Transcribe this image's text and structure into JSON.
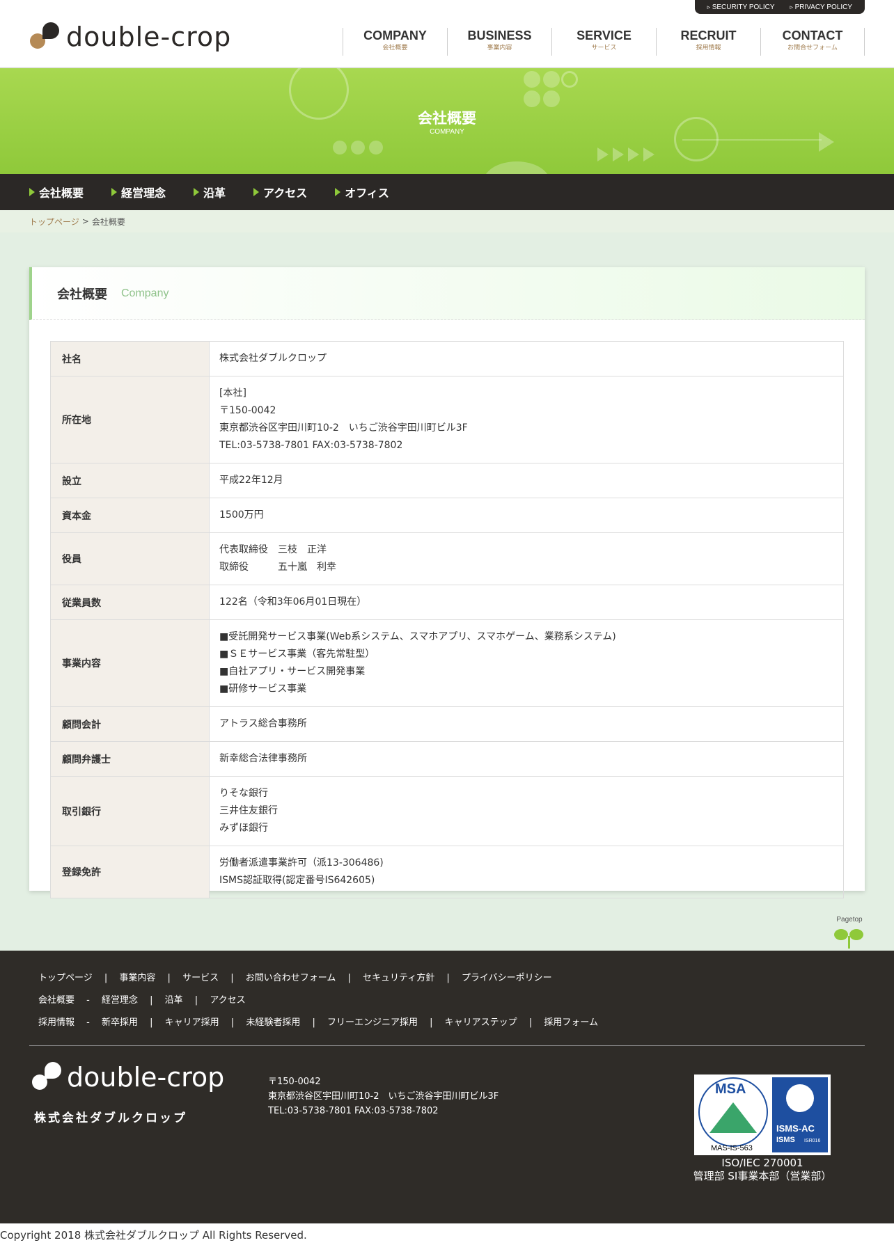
{
  "header": {
    "logo_text": "double-crop",
    "utility": [
      "SECURITY POLICY",
      "PRIVACY POLICY"
    ],
    "nav": [
      {
        "en": "COMPANY",
        "ja": "会社概要"
      },
      {
        "en": "BUSINESS",
        "ja": "事業内容"
      },
      {
        "en": "SERVICE",
        "ja": "サービス"
      },
      {
        "en": "RECRUIT",
        "ja": "採用情報"
      },
      {
        "en": "CONTACT",
        "ja": "お問合せフォーム"
      }
    ]
  },
  "hero": {
    "title": "会社概要",
    "subtitle": "COMPANY"
  },
  "subnav": [
    "会社概要",
    "経営理念",
    "沿革",
    "アクセス",
    "オフィス"
  ],
  "breadcrumb": {
    "home": "トップページ",
    "sep": ">",
    "current": "会社概要"
  },
  "card": {
    "title": "会社概要",
    "title_en": "Company",
    "rows": [
      {
        "label": "社名",
        "lines": [
          "株式会社ダブルクロップ"
        ]
      },
      {
        "label": "所在地",
        "lines": [
          "[本社]",
          "〒150-0042",
          "東京都渋谷区宇田川町10-2　いちご渋谷宇田川町ビル3F",
          "TEL:03-5738-7801 FAX:03-5738-7802"
        ]
      },
      {
        "label": "設立",
        "lines": [
          "平成22年12月"
        ]
      },
      {
        "label": "資本金",
        "lines": [
          "1500万円"
        ]
      },
      {
        "label": "役員",
        "lines": [
          "代表取締役　三枝　正洋",
          "取締役　　　五十嵐　利幸"
        ]
      },
      {
        "label": "従業員数",
        "lines": [
          "122名（令和3年06月01日現在）"
        ]
      },
      {
        "label": "事業内容",
        "lines": [
          "■受託開発サービス事業(Web系システム、スマホアプリ、スマホゲーム、業務系システム)",
          "■ＳＥサービス事業（客先常駐型）",
          "■自社アプリ・サービス開発事業",
          "■研修サービス事業"
        ]
      },
      {
        "label": "顧問会計",
        "lines": [
          "アトラス総合事務所"
        ]
      },
      {
        "label": "顧問弁護士",
        "lines": [
          "新幸総合法律事務所"
        ]
      },
      {
        "label": "取引銀行",
        "lines": [
          "りそな銀行",
          "三井住友銀行",
          "みずほ銀行"
        ]
      },
      {
        "label": "登録免許",
        "lines": [
          "労働者派遣事業許可（派13-306486)",
          "ISMS認証取得(認定番号IS642605)"
        ]
      }
    ]
  },
  "pagetop": "Pagetop",
  "footer": {
    "row1": [
      "トップページ",
      "事業内容",
      "サービス",
      "お問い合わせフォーム",
      "セキュリティ方針",
      "プライバシーポリシー"
    ],
    "row2_head": "会社概要",
    "row2": [
      "経営理念",
      "沿革",
      "アクセス"
    ],
    "row3_head": "採用情報",
    "row3": [
      "新卒採用",
      "キャリア採用",
      "未経験者採用",
      "フリーエンジニア採用",
      "キャリアステップ",
      "採用フォーム"
    ],
    "logo_text": "double-crop",
    "company": "株式会社ダブルクロップ",
    "address": [
      "〒150-0042",
      "東京都渋谷区宇田川町10-2　いちご渋谷宇田川町ビル3F",
      "TEL:03-5738-7801 FAX:03-5738-7802"
    ],
    "cert": {
      "msa": "MSA",
      "msa_code": "MAS-IS-563",
      "isms": "ISMS-AC",
      "isms2": "ISMS",
      "isms_code": "ISR016"
    },
    "cert_caption": [
      "ISO/IEC 270001",
      "管理部 SI事業本部（営業部）"
    ]
  },
  "copyright": "Copyright 2018 株式会社ダブルクロップ All Rights Reserved."
}
